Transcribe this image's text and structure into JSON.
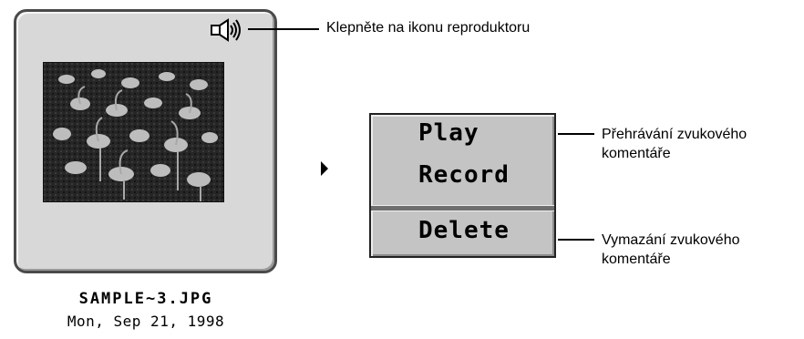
{
  "thumbnail": {
    "file_name": "SAMPLE~3.JPG",
    "date": "Mon, Sep 21, 1998",
    "speaker_icon": "speaker-icon",
    "photo_icon": "flamingo-photo"
  },
  "callouts": {
    "speaker": "Klepněte na ikonu reproduktoru",
    "play": "Přehrávání zvukového komentáře",
    "delete": "Vymazání zvukového komentáře"
  },
  "menu": {
    "items": [
      {
        "label": "Play"
      },
      {
        "label": "Record"
      },
      {
        "label": "Delete"
      }
    ]
  }
}
